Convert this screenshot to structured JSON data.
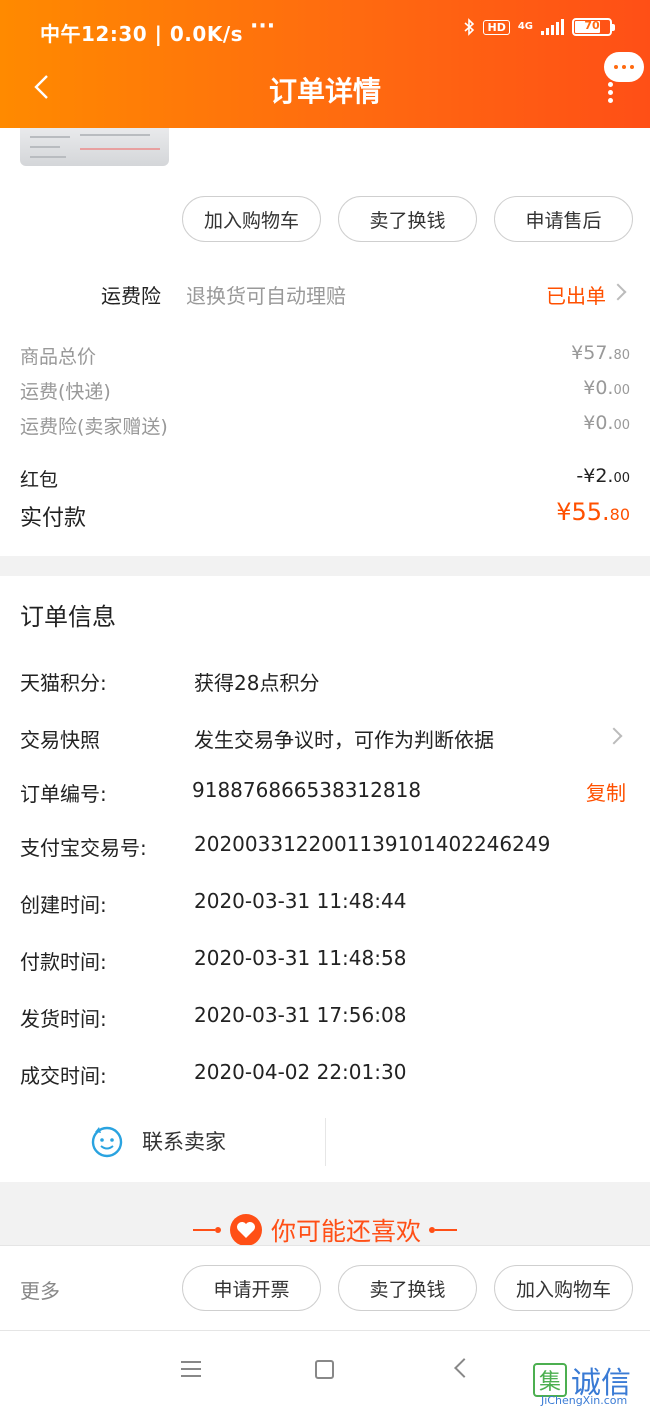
{
  "status_bar": {
    "time": "中午12:30 | 0.0K/s",
    "moon_icon": "moon-icon",
    "dots": "···",
    "hd": "HD",
    "network": "4G",
    "battery": "70"
  },
  "header": {
    "title": "订单详情",
    "back_icon": "chevron-left-icon",
    "more_icon": "chat-bubble-more-icon",
    "color_start": "#ff8a00",
    "color_end": "#ff4f16"
  },
  "actions_top": {
    "add_cart": "加入购物车",
    "resell": "卖了换钱",
    "after_sale": "申请售后"
  },
  "shipping_insurance": {
    "label": "运费险",
    "description": "退换货可自动理赔",
    "status": "已出单"
  },
  "fees": {
    "goods_total_label": "商品总价",
    "goods_total_main": "¥57.",
    "goods_total_cents": "80",
    "shipping_label": "运费(快递)",
    "shipping_main": "¥0.",
    "shipping_cents": "00",
    "insurance_label": "运费险(卖家赠送)",
    "insurance_main": "¥0.",
    "insurance_cents": "00",
    "red_packet_label": "红包",
    "red_packet_main": "-¥2.",
    "red_packet_cents": "00",
    "paid_label": "实付款",
    "paid_main": "¥55.",
    "paid_cents": "80"
  },
  "order_info": {
    "title": "订单信息",
    "points_label": "天猫积分:",
    "points_value": "获得28点积分",
    "snapshot_label": "交易快照",
    "snapshot_value": "发生交易争议时，可作为判断依据",
    "order_no_label": "订单编号:",
    "order_no_value": "918876866538312818",
    "copy_label": "复制",
    "alipay_label": "支付宝交易号:",
    "alipay_value": "2020033122001139101402246249",
    "created_label": "创建时间:",
    "created_value": "2020-03-31 11:48:44",
    "paid_label": "付款时间:",
    "paid_value": "2020-03-31 11:48:58",
    "shipped_label": "发货时间:",
    "shipped_value": "2020-03-31 17:56:08",
    "closed_label": "成交时间:",
    "closed_value": "2020-04-02 22:01:30"
  },
  "contact": {
    "label": "联系卖家",
    "icon": "smiley-chat-icon"
  },
  "recommend": {
    "title": "你可能还喜欢",
    "icon": "heart-icon"
  },
  "bottom_bar": {
    "more": "更多",
    "invoice": "申请开票",
    "resell": "卖了换钱",
    "add_cart": "加入购物车"
  },
  "nav_bar": {
    "menu_icon": "menu-icon",
    "home_icon": "square-home-icon",
    "back_icon": "triangle-back-icon"
  },
  "watermark": {
    "logo": "集",
    "text": "诚信",
    "url": "JiChengXin.com"
  },
  "accent_color": "#ff5000"
}
